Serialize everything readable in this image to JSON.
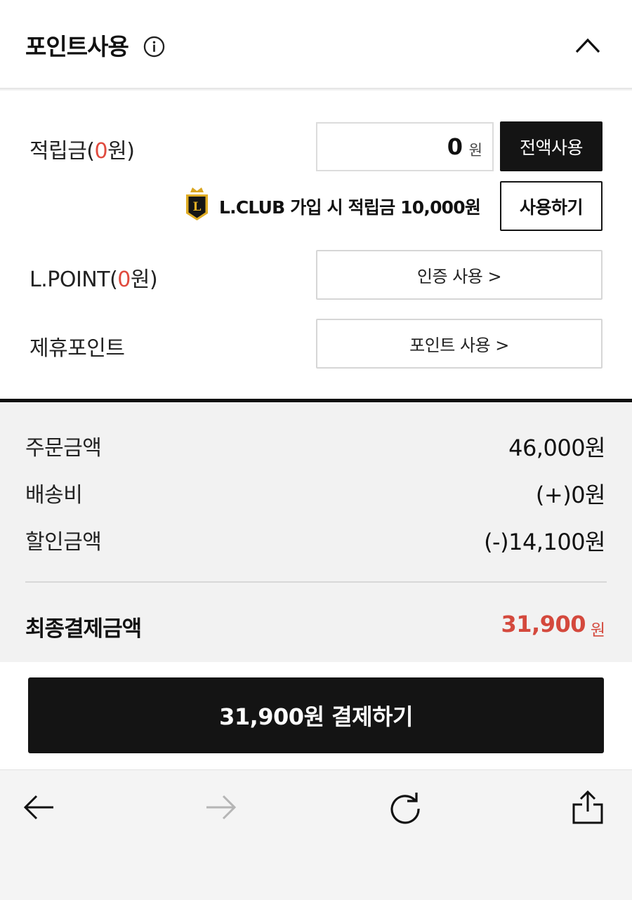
{
  "header": {
    "title": "포인트사용"
  },
  "points": {
    "reserve": {
      "label_prefix": "적립금(",
      "label_amount": "0",
      "label_suffix": "원)",
      "input_value": "0",
      "input_unit": "원",
      "full_use_label": "전액사용"
    },
    "lclub": {
      "badge_letter": "L",
      "promo_text": "L.CLUB 가입 시 적립금 10,000원",
      "use_label": "사용하기"
    },
    "lpoint": {
      "label_prefix": "L.POINT(",
      "label_amount": "0",
      "label_suffix": "원)",
      "button_label": "인증 사용 >"
    },
    "partner": {
      "label": "제휴포인트",
      "button_label": "포인트 사용 >"
    }
  },
  "summary": {
    "order_label": "주문금액",
    "order_value": "46,000원",
    "shipping_label": "배송비",
    "shipping_value": "(+)0원",
    "discount_label": "할인금액",
    "discount_value": "(-)14,100원",
    "final_label": "최종결제금액",
    "final_value": "31,900",
    "final_unit": "원"
  },
  "pay": {
    "button_label": "31,900원 결제하기"
  },
  "colors": {
    "accent_red": "#e04b3f",
    "black": "#141414"
  }
}
